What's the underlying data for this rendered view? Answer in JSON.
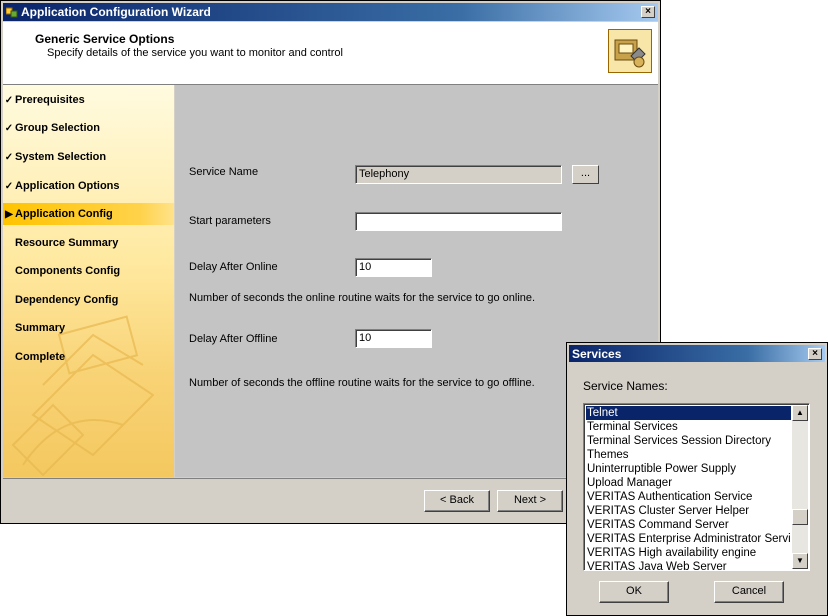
{
  "wizard": {
    "title": "Application Configuration Wizard",
    "header_title": "Generic Service Options",
    "header_subtitle": "Specify details of the service you want to monitor and control",
    "steps": [
      {
        "label": "Prerequisites",
        "mark": "✓"
      },
      {
        "label": "Group Selection",
        "mark": "✓"
      },
      {
        "label": "System Selection",
        "mark": "✓"
      },
      {
        "label": "Application Options",
        "mark": "✓"
      },
      {
        "label": "Application Config",
        "mark": "▶"
      },
      {
        "label": "Resource Summary",
        "mark": ""
      },
      {
        "label": "Components Config",
        "mark": ""
      },
      {
        "label": "Dependency Config",
        "mark": ""
      },
      {
        "label": "Summary",
        "mark": ""
      },
      {
        "label": "Complete",
        "mark": ""
      }
    ],
    "form": {
      "service_name_label": "Service Name",
      "service_name_value": "Telephony",
      "browse_label": "...",
      "start_params_label": "Start parameters",
      "start_params_value": "",
      "delay_online_label": "Delay After Online",
      "delay_online_value": "10",
      "delay_online_help": "Number of seconds the online routine waits for the service to go online.",
      "delay_offline_label": "Delay After Offline",
      "delay_offline_value": "10",
      "delay_offline_help": "Number of seconds the offline routine waits for the service to go offline."
    },
    "buttons": {
      "back": "< Back",
      "next": "Next >"
    }
  },
  "services_dialog": {
    "title": "Services",
    "close": "×",
    "list_label": "Service Names:",
    "items": [
      "Telnet",
      "Terminal Services",
      "Terminal Services Session Directory",
      "Themes",
      "Uninterruptible Power Supply",
      "Upload Manager",
      "VERITAS Authentication Service",
      "VERITAS Cluster Server Helper",
      "VERITAS Command Server",
      "VERITAS Enterprise Administrator Servic",
      "VERITAS High availability engine",
      "VERITAS Java Web Server"
    ],
    "selected_index": 0,
    "ok": "OK",
    "cancel": "Cancel"
  },
  "icons": {
    "close": "×",
    "scroll_up": "▲",
    "scroll_down": "▼"
  }
}
